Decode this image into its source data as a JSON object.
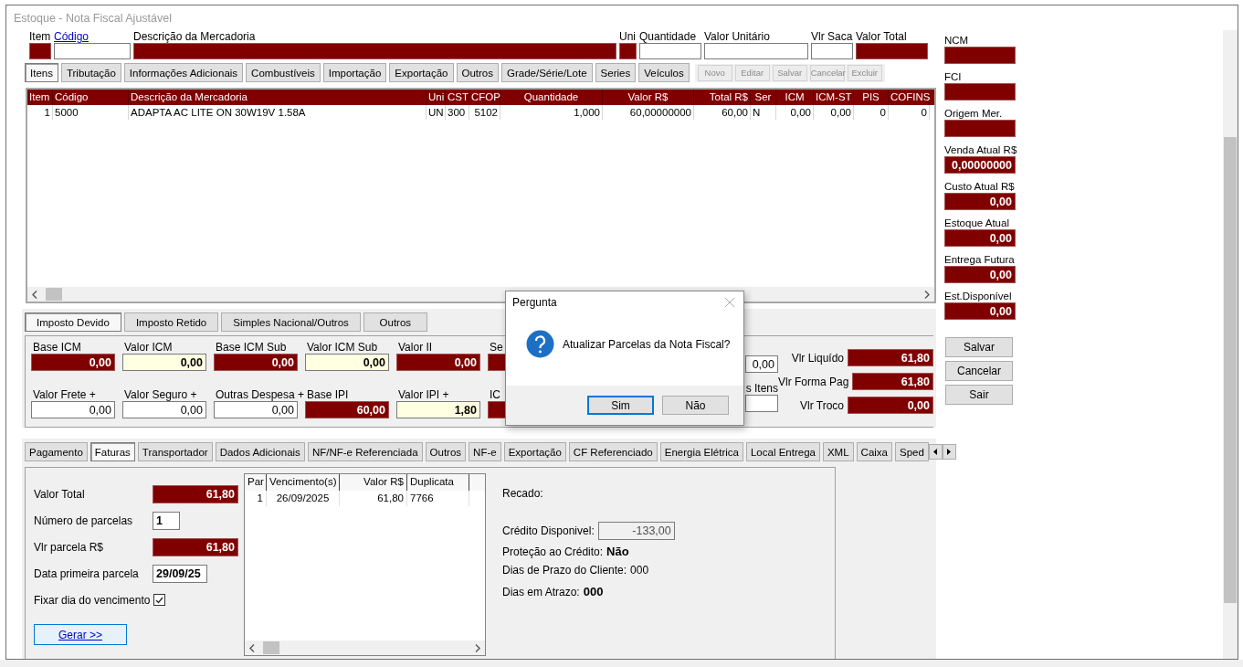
{
  "window": {
    "title": "Estoque - Nota Fiscal Ajustável"
  },
  "item_fields": [
    {
      "label": "Item",
      "kind": "dark"
    },
    {
      "label": "Código",
      "kind": "white",
      "link": true
    },
    {
      "label": "Descrição da Mercadoria",
      "kind": "dark"
    },
    {
      "label": "Uni",
      "kind": "dark"
    },
    {
      "label": "Quantidade",
      "kind": "white"
    },
    {
      "label": "Valor Unitário",
      "kind": "white"
    },
    {
      "label": "Vlr Saca",
      "kind": "white"
    },
    {
      "label": "Valor Total",
      "kind": "dark"
    }
  ],
  "item_tabs": [
    {
      "label": "Itens",
      "selected": true
    },
    {
      "label": "Tributação",
      "selected": false
    },
    {
      "label": "Informações Adicionais",
      "selected": false
    },
    {
      "label": "Combustíveis",
      "selected": false
    },
    {
      "label": "Importação",
      "selected": false
    },
    {
      "label": "Exportação",
      "selected": false
    },
    {
      "label": "Outros",
      "selected": false
    },
    {
      "label": "Grade/Série/Lote",
      "selected": false
    },
    {
      "label": "Series",
      "selected": false
    },
    {
      "label": "Veículos",
      "selected": false
    }
  ],
  "item_actions": [
    {
      "label": "Novo",
      "disabled": true
    },
    {
      "label": "Editar",
      "disabled": true
    },
    {
      "label": "Salvar",
      "disabled": true
    },
    {
      "label": "Cancelar",
      "disabled": true
    },
    {
      "label": "Excluir",
      "disabled": true
    }
  ],
  "items_table": {
    "columns": [
      "Item",
      "Código",
      "Descrição da Mercadoria",
      "Uni",
      "CST",
      "CFOP",
      "Quantidade",
      "Valor R$",
      "Total R$",
      "Ser",
      "ICM",
      "ICM-ST",
      "PIS",
      "COFINS"
    ],
    "rows": [
      [
        "1",
        "5000",
        "ADAPTA AC LITE ON 30W19V 1.58A",
        "UN",
        "300",
        "5102",
        "1,000",
        "60,00000000",
        "60,00",
        "N",
        "0,00",
        "0,00",
        "0",
        "0"
      ]
    ]
  },
  "side_fields": [
    {
      "label": "NCM"
    },
    {
      "label": "FCI"
    },
    {
      "label": "Origem Mer."
    },
    {
      "label": "Venda Atual R$",
      "value": "0,00000000"
    },
    {
      "label": "Custo Atual R$",
      "value": "0,00"
    },
    {
      "label": "Estoque Atual",
      "value": "0,00"
    },
    {
      "label": "Entrega Futura",
      "value": "0,00"
    },
    {
      "label": "Est.Disponível",
      "value": "0,00"
    }
  ],
  "side_buttons": [
    "Salvar",
    "Cancelar",
    "Sair"
  ],
  "tax_tabs": [
    {
      "label": "Imposto Devido",
      "selected": true
    },
    {
      "label": "Imposto Retido",
      "selected": false
    },
    {
      "label": "Simples Nacional/Outros",
      "selected": false
    },
    {
      "label": "Outros",
      "selected": false
    }
  ],
  "tax_fields": [
    {
      "label": "Base ICM",
      "value": "0,00",
      "kind": "dark"
    },
    {
      "label": "Valor ICM",
      "value": "0,00",
      "kind": "cream"
    },
    {
      "label": "Base ICM Sub",
      "value": "0,00",
      "kind": "dark"
    },
    {
      "label": "Valor ICM Sub",
      "value": "0,00",
      "kind": "cream"
    },
    {
      "label": "Valor II",
      "value": "0,00",
      "kind": "dark"
    },
    {
      "label": "Se",
      "kind": "dark"
    },
    {
      "label": "Valor Frete +",
      "value": "0,00",
      "kind": "white"
    },
    {
      "label": "Valor Seguro +",
      "value": "0,00",
      "kind": "white"
    },
    {
      "label": "Outras Despesa +",
      "value": "0,00",
      "kind": "white"
    },
    {
      "label": "Base IPI",
      "value": "60,00",
      "kind": "dark"
    },
    {
      "label": "Valor IPI +",
      "value": "1,80",
      "kind": "cream"
    },
    {
      "label": "IC",
      "kind": "dark"
    }
  ],
  "tax_extra": [
    {
      "value": "0,00"
    },
    {
      "label": "s Itens"
    }
  ],
  "totals": [
    {
      "label": "Vlr Liquído",
      "value": "61,80"
    },
    {
      "label": "Vlr Forma Pag",
      "value": "61,80"
    },
    {
      "label": "Vlr Troco",
      "value": "0,00"
    }
  ],
  "invoice_tabs": [
    {
      "label": "Pagamento",
      "selected": false
    },
    {
      "label": "Faturas",
      "selected": true
    },
    {
      "label": "Transportador",
      "selected": false
    },
    {
      "label": "Dados Adicionais",
      "selected": false
    },
    {
      "label": "NF/NF-e Referenciada",
      "selected": false
    },
    {
      "label": "Outros",
      "selected": false
    },
    {
      "label": "NF-e",
      "selected": false
    },
    {
      "label": "Exportação",
      "selected": false
    },
    {
      "label": "CF Referenciado",
      "selected": false
    },
    {
      "label": "Energia Elétrica",
      "selected": false
    },
    {
      "label": "Local Entrega",
      "selected": false
    },
    {
      "label": "XML",
      "selected": false
    },
    {
      "label": "Caixa",
      "selected": false
    },
    {
      "label": "Sped",
      "selected": false
    }
  ],
  "installment_fields": [
    {
      "label": "Valor Total",
      "value": "61,80",
      "kind": "amount"
    },
    {
      "label": "Número de parcelas",
      "value": "1",
      "kind": "count"
    },
    {
      "label": "Vlr parcela R$",
      "value": "61,80",
      "kind": "amount"
    },
    {
      "label": "Data primeira parcela",
      "value": "29/09/25",
      "kind": "date"
    }
  ],
  "fix_due_day": {
    "label": "Fixar dia do vencimento",
    "checked": true
  },
  "generate_button": "Gerar >>",
  "installments_table": {
    "columns": [
      "Par",
      "Vencimento(s)",
      "Valor R$",
      "Duplicata"
    ],
    "rows": [
      [
        "1",
        "26/09/2025",
        "61,80",
        "7766"
      ]
    ]
  },
  "credit_info": {
    "recado": "Recado:",
    "credit": {
      "label": "Crédito Disponivel:",
      "value": "-133,00"
    },
    "protection": {
      "label": "Proteção ao Crédito:",
      "value": "Não"
    },
    "term": {
      "label": "Dias de Prazo do Cliente:",
      "value": "000"
    },
    "overdue": {
      "label": "Dias em Atrazo:",
      "value": "000"
    }
  },
  "dialog": {
    "title": "Pergunta",
    "message": "Atualizar Parcelas da Nota Fiscal?",
    "buttons": [
      {
        "label": "Sim",
        "selected": true
      },
      {
        "label": "Não",
        "selected": false
      }
    ]
  }
}
